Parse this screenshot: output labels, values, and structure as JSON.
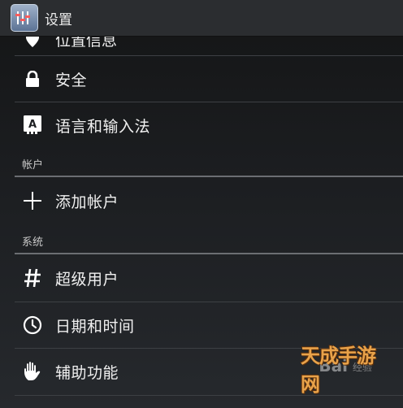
{
  "action_bar": {
    "title": "设置",
    "app_icon": "settings-app-icon"
  },
  "partial_row": {
    "label": "位置信息",
    "icon": "location-icon"
  },
  "rows_top": [
    {
      "label": "安全",
      "icon": "lock-icon"
    },
    {
      "label": "语言和输入法",
      "icon": "keyboard-language-icon"
    }
  ],
  "section_accounts": {
    "header": "帐户",
    "rows": [
      {
        "label": "添加帐户",
        "icon": "plus-icon"
      }
    ]
  },
  "section_system": {
    "header": "系统",
    "rows": [
      {
        "label": "超级用户",
        "icon": "hash-icon"
      },
      {
        "label": "日期和时间",
        "icon": "clock-icon"
      },
      {
        "label": "辅助功能",
        "icon": "hand-icon"
      }
    ]
  },
  "watermark": {
    "brand": "Bai",
    "brand_suffix": "经验",
    "site": "天成手游网"
  },
  "colors": {
    "background": "#1d1f22",
    "divider": "#3d4044",
    "section_line": "#6b6e72",
    "text": "#f0f0f0"
  }
}
